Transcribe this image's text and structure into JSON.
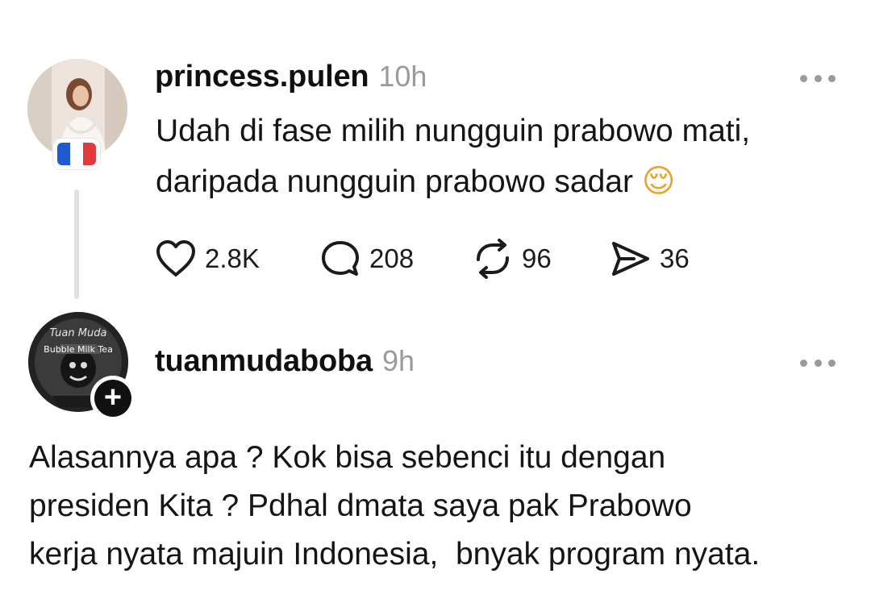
{
  "post": {
    "username": "princess.pulen",
    "time": "10h",
    "text_line1": "Udah di fase milih nungguin prabowo mati,",
    "text_line2": "daripada nungguin prabowo sadar",
    "emoji": "😌",
    "flag_icon": "france-flag-icon",
    "flag_colors": [
      "#1f5ad1",
      "#ffffff",
      "#e03a3e"
    ],
    "stats": {
      "likes": "2.8K",
      "replies": "208",
      "reposts": "96",
      "shares": "36"
    }
  },
  "reply": {
    "username": "tuanmudaboba",
    "time": "9h",
    "text_line1": "Alasannya apa ? Kok bisa sebenci itu dengan",
    "text_line2": "presiden Kita ? Pdhal dmata saya pak Prabowo",
    "text_line3": "kerja nyata majuin Indonesia,  bnyak program nyata.",
    "avatar_text_top": "Tuan Muda",
    "avatar_text_mid": "Bubble Milk Tea",
    "follow_symbol": "+"
  }
}
